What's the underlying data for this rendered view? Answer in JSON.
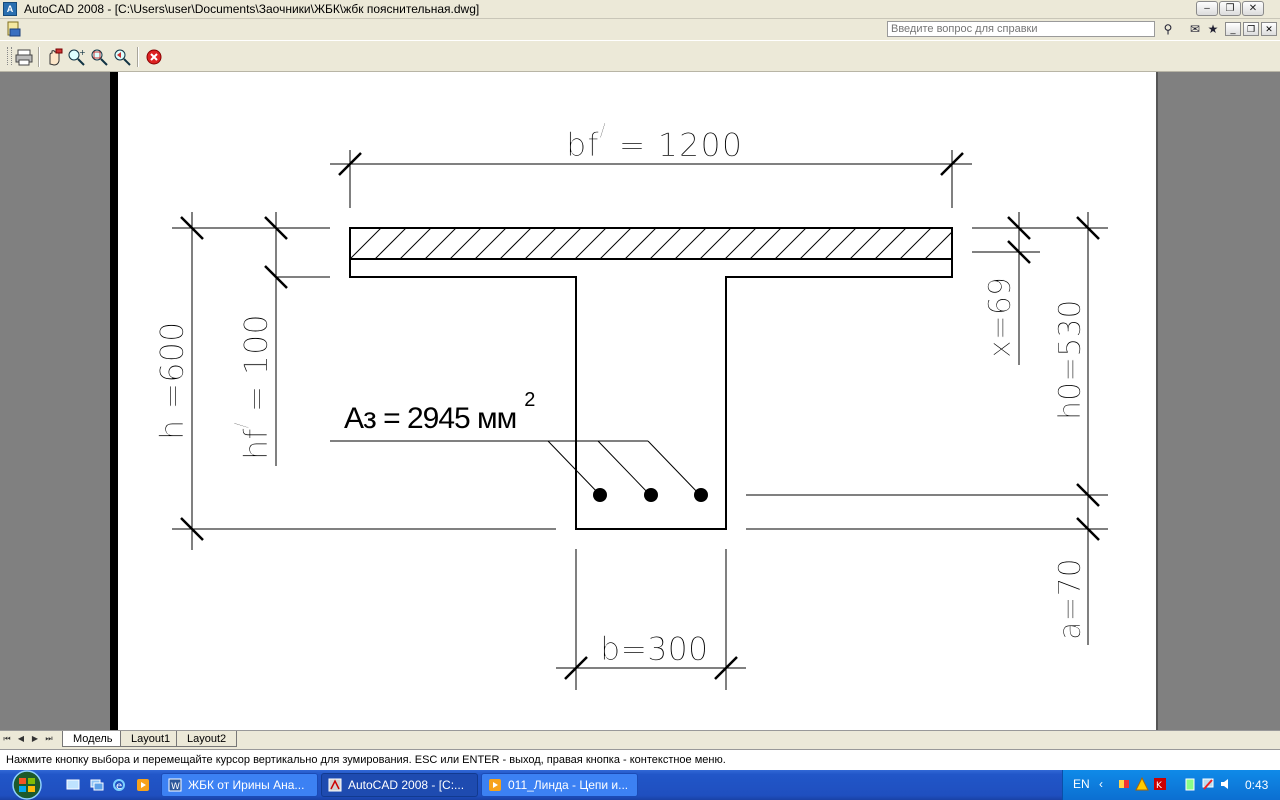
{
  "window": {
    "app_icon": "autocad-icon",
    "title": "AutoCAD 2008 - [C:\\Users\\user\\Documents\\Заочники\\ЖБК\\жбк пояснительная.dwg]",
    "minimize": "–",
    "restore": "❐",
    "close": "✕"
  },
  "menu_row": {
    "help_placeholder": "Введите вопрос для справки",
    "mdi_min": "_",
    "mdi_restore": "❐",
    "mdi_close": "✕"
  },
  "toolbar": {
    "icons": [
      "print-icon",
      "pan-icon",
      "zoom-realtime-icon",
      "zoom-window-icon",
      "zoom-previous-icon",
      "close-preview-icon"
    ]
  },
  "drawing": {
    "flange_width": "bf′ = 1200",
    "flange_width_main": "bf",
    "flange_width_prime": "/",
    "flange_width_value": "=  1200",
    "total_height": "h =600",
    "flange_thickness_main": "hf",
    "flange_thickness_prime": "/",
    "flange_thickness_value": "=  100",
    "compression_zone": "x=69",
    "effective_depth": "h0=530",
    "cover": "a=70",
    "web_width": "b=300",
    "rebar_area_main": "Aз = 2945 мм",
    "rebar_area_sup": "2",
    "rebar_count": 3
  },
  "layout_tabs": {
    "tabs": [
      "Модель",
      "Layout1",
      "Layout2"
    ],
    "active": 0
  },
  "command_line": {
    "text": "Нажмите кнопку выбора и перемещайте курсор вертикально для зумирования. ESC или ENTER - выход, правая кнопка - контекстное меню."
  },
  "taskbar": {
    "tasks": [
      {
        "label": "ЖБК от Ирины Ана...",
        "icon": "word-icon"
      },
      {
        "label": "AutoCAD 2008 - [C:...",
        "icon": "autocad-icon"
      },
      {
        "label": "011_Линда - Цепи и...",
        "icon": "media-player-icon"
      }
    ],
    "active_task": 1,
    "language": "EN",
    "clock": "0:43"
  },
  "colors": {
    "taskbar_blue": "#2156c8",
    "tray_blue": "#0c6fd1",
    "window_bg": "#ece9d8",
    "model_space_gray": "#808080"
  }
}
